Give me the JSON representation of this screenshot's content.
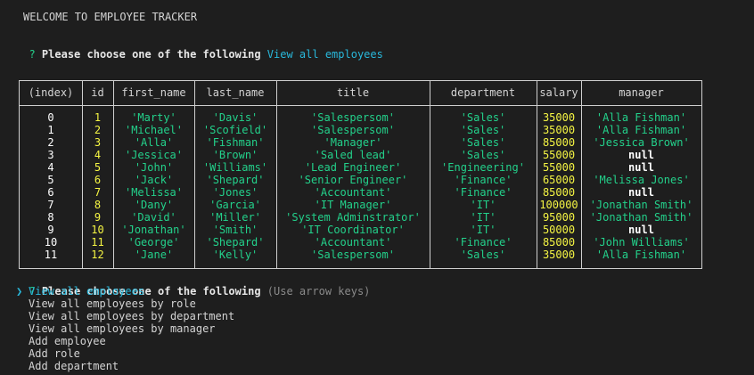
{
  "welcome": "WELCOME TO EMPLOYEE TRACKER",
  "prompt1": {
    "mark": "?",
    "question": "Please choose one of the following",
    "answer": "View all employees"
  },
  "table": {
    "columns": [
      "(index)",
      "id",
      "first_name",
      "last_name",
      "title",
      "department",
      "salary",
      "manager"
    ],
    "rows": [
      [
        "0",
        "1",
        "'Marty'",
        "'Davis'",
        "'Salespersom'",
        "'Sales'",
        "35000",
        "'Alla Fishman'"
      ],
      [
        "1",
        "2",
        "'Michael'",
        "'Scofield'",
        "'Salespersom'",
        "'Sales'",
        "35000",
        "'Alla Fishman'"
      ],
      [
        "2",
        "3",
        "'Alla'",
        "'Fishman'",
        "'Manager'",
        "'Sales'",
        "85000",
        "'Jessica Brown'"
      ],
      [
        "3",
        "4",
        "'Jessica'",
        "'Brown'",
        "'Saled lead'",
        "'Sales'",
        "55000",
        "null"
      ],
      [
        "4",
        "5",
        "'John'",
        "'Williams'",
        "'Lead Engineer'",
        "'Engineering'",
        "55000",
        "null"
      ],
      [
        "5",
        "6",
        "'Jack'",
        "'Shepard'",
        "'Senior Engineer'",
        "'Finance'",
        "65000",
        "'Melissa Jones'"
      ],
      [
        "6",
        "7",
        "'Melissa'",
        "'Jones'",
        "'Accountant'",
        "'Finance'",
        "85000",
        "null"
      ],
      [
        "7",
        "8",
        "'Dany'",
        "'Garcia'",
        "'IT Manager'",
        "'IT'",
        "100000",
        "'Jonathan Smith'"
      ],
      [
        "8",
        "9",
        "'David'",
        "'Miller'",
        "'System Adminstrator'",
        "'IT'",
        "95000",
        "'Jonathan Smith'"
      ],
      [
        "9",
        "10",
        "'Jonathan'",
        "'Smith'",
        "'IT Coordinator'",
        "'IT'",
        "50000",
        "null"
      ],
      [
        "10",
        "11",
        "'George'",
        "'Shepard'",
        "'Accountant'",
        "'Finance'",
        "85000",
        "'John Williams'"
      ],
      [
        "11",
        "12",
        "'Jane'",
        "'Kelly'",
        "'Salespersom'",
        "'Sales'",
        "35000",
        "'Alla Fishman'"
      ]
    ]
  },
  "prompt2": {
    "mark": "?",
    "question": "Please choose one of the following",
    "hint": "(Use arrow keys)",
    "pointer": "❯",
    "options": [
      "View all employees",
      "View all employees by role",
      "View all employees by department",
      "View all employees by manager",
      "Add employee",
      "Add role",
      "Add department"
    ],
    "selected_index": 0
  },
  "colors": {
    "background": "#1e1e1e",
    "cyan": "#29b8db",
    "green": "#23d18b",
    "yellow": "#f5f543"
  }
}
